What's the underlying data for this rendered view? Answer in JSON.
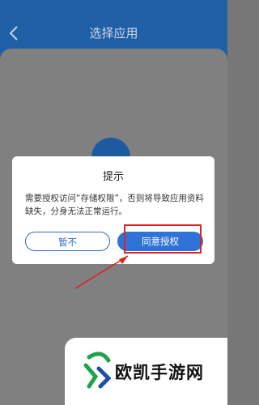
{
  "header": {
    "title": "选择应用"
  },
  "dialog": {
    "title": "提示",
    "message": "需要授权访问“存储权限”，否则将导致应用资料缺失，分身无法正常运行。",
    "cancel_label": "暂不",
    "agree_label": "同意授权"
  },
  "watermark": {
    "text": "欧凯手游网"
  },
  "colors": {
    "header_bg": "#1f5fa6",
    "primary": "#2f73d8",
    "highlight": "#e02020"
  },
  "icons": {
    "back": "chevron-left-icon",
    "app": "app-cube-icon",
    "logo": "brand-logo-icon"
  }
}
